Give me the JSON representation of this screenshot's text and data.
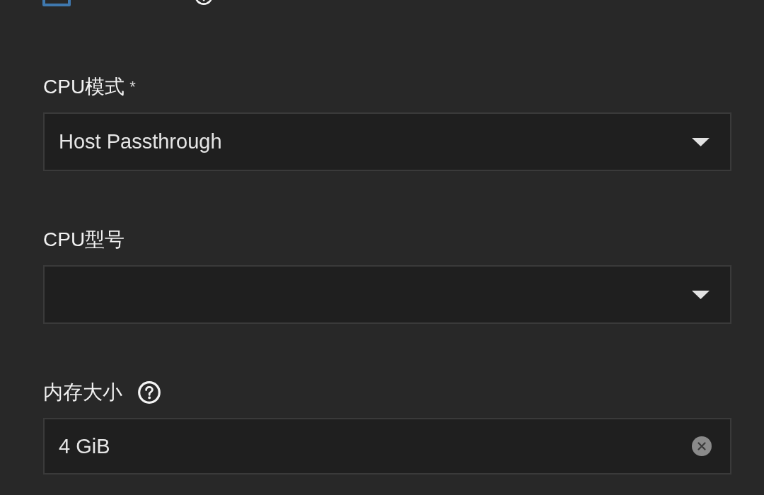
{
  "top_option": {
    "checked": false,
    "help": true
  },
  "fields": [
    {
      "kind": "select",
      "label": "CPU模式",
      "required_mark": "*",
      "value": "Host Passthrough"
    },
    {
      "kind": "select",
      "label": "CPU型号"
    },
    {
      "kind": "input",
      "label": "内存大小",
      "help": true,
      "value": "4 GiB",
      "clearable": true
    }
  ]
}
